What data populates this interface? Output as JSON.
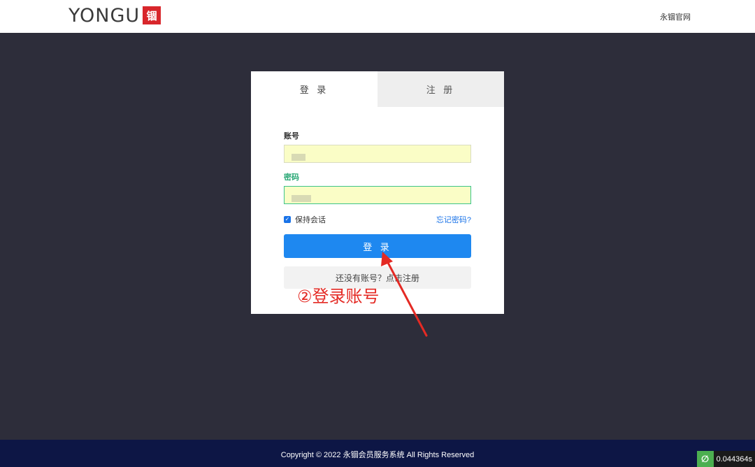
{
  "header": {
    "logo_text": "YONGU",
    "logo_seal": "永錋",
    "site_link": "永锢官网"
  },
  "tabs": [
    {
      "label": "登 录",
      "active": true
    },
    {
      "label": "注 册",
      "active": false
    }
  ],
  "form": {
    "account_label": "账号",
    "account_value": "",
    "password_label": "密码",
    "password_value": "",
    "remember_label": "保持会话",
    "remember_checked": true,
    "forgot_link": "忘记密码?",
    "login_button": "登 录",
    "register_button": "还没有账号？点击注册"
  },
  "annotation": {
    "text": "②登录账号",
    "color": "#e42a24"
  },
  "footer": {
    "copyright": "Copyright © 2022 永锢会员服务系统 All Rights Reserved",
    "timer": "0.044364s"
  },
  "colors": {
    "background": "#2d2d3a",
    "primary": "#1e88f0",
    "footer": "#0d1645",
    "input_bg": "#fafdc6"
  }
}
